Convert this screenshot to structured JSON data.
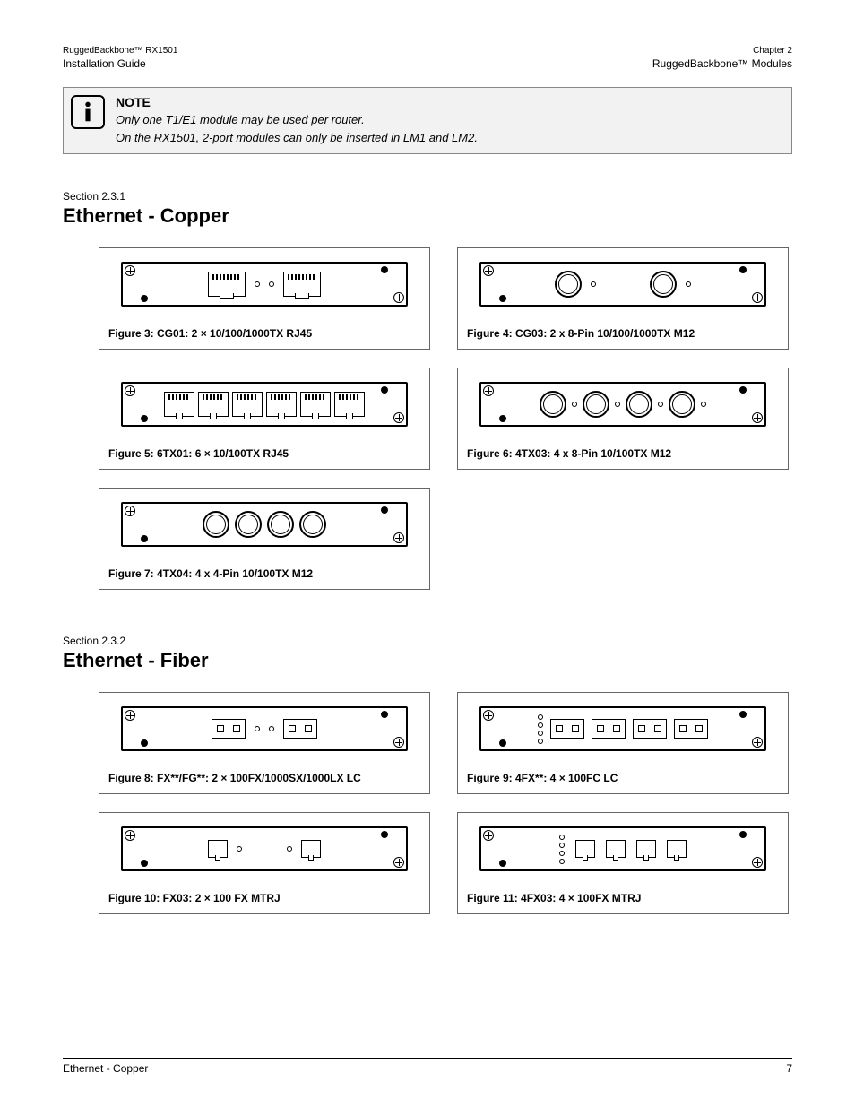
{
  "header": {
    "top_left": "RuggedBackbone™ RX1501",
    "top_right": "Chapter 2",
    "sub_left": "Installation Guide",
    "sub_right": "RuggedBackbone™ Modules"
  },
  "note": {
    "title": "NOTE",
    "line1": "Only one T1/E1 module may be used per router.",
    "line2": "On the RX1501, 2-port modules can only be inserted in LM1 and LM2."
  },
  "sections": {
    "copper": {
      "label": "Section 2.3.1",
      "title": "Ethernet - Copper"
    },
    "fiber": {
      "label": "Section 2.3.2",
      "title": "Ethernet - Fiber"
    }
  },
  "figures": {
    "f3": "Figure 3: CG01: 2 × 10/100/1000TX RJ45",
    "f4": "Figure 4: CG03: 2 x 8-Pin 10/100/1000TX M12",
    "f5": "Figure 5: 6TX01: 6 × 10/100TX RJ45",
    "f6": "Figure 6: 4TX03: 4 x 8-Pin 10/100TX M12",
    "f7": "Figure 7: 4TX04: 4 x 4-Pin 10/100TX M12",
    "f8": "Figure 8: FX**/FG**: 2 × 100FX/1000SX/1000LX LC",
    "f9": "Figure 9: 4FX**: 4 × 100FC LC",
    "f10": "Figure 10: FX03: 2 × 100 FX MTRJ",
    "f11": "Figure 11: 4FX03: 4 × 100FX MTRJ"
  },
  "footer": {
    "left": "Ethernet - Copper",
    "right": "7"
  }
}
